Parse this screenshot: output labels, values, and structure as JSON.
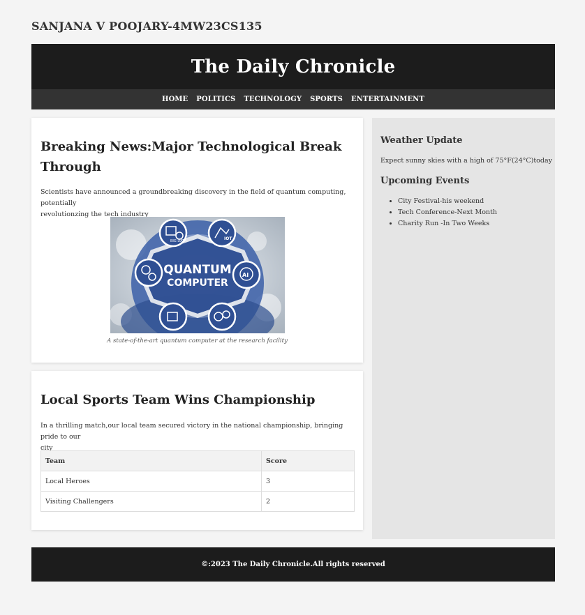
{
  "author": "SANJANA V POOJARY-4MW23CS135",
  "site_title": "The Daily Chronicle",
  "nav": [
    "HOME",
    "POLITICS",
    "TECHNOLOGY",
    "SPORTS",
    "ENTERTAINMENT"
  ],
  "article1": {
    "title_line1": "Breaking News:Major Technological Break",
    "title_line2": "Through",
    "body_line1": "Scientists have announced a groundbreaking discovery in the field of quantum computing, potentially",
    "body_line2": "revolutionzing the tech industry",
    "image_text_line1": "QUANTUM",
    "image_text_line2": "COMPUTER",
    "image_icon_labels": [
      "BIG DATA",
      "IOT",
      "AI"
    ],
    "caption": "A state-of-the-art quantum computer at the research facility"
  },
  "article2": {
    "title": "Local Sports Team Wins Championship",
    "body_line1": "In a thrilling match,our local team secured victory in the national championship, bringing pride to our",
    "body_line2": "city",
    "table": {
      "headers": [
        "Team",
        "Score"
      ],
      "rows": [
        [
          "Local Heroes",
          "3"
        ],
        [
          "Visiting Challengers",
          "2"
        ]
      ]
    }
  },
  "sidebar": {
    "weather_title": "Weather Update",
    "weather_text": "Expect sunny skies with a high of 75°F(24°C)today",
    "events_title": "Upcoming Events",
    "events": [
      "City Festival-his weekend",
      "Tech Conference-Next Month",
      "Charity Run -In Two Weeks"
    ]
  },
  "footer": "©:2023 The Daily Chronicle.All rights reserved"
}
